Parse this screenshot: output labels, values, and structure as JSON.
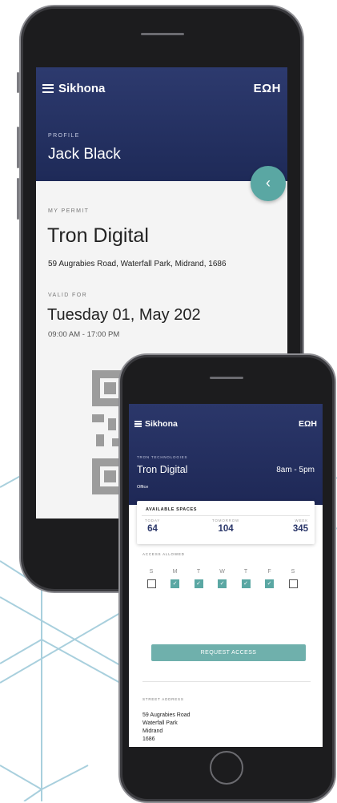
{
  "colors": {
    "header_navy": "#24316a",
    "accent_teal": "#5aa7a3",
    "pattern_blue": "#7fb6c9"
  },
  "icons": {
    "menu": "hamburger-icon",
    "back": "chevron-left-icon",
    "qr": "qr-code-icon",
    "check": "check-icon"
  },
  "large_screen": {
    "app_name": "Sikhona",
    "brand_logo": "EΩH",
    "profile_label": "PROFILE",
    "profile_name": "Jack Black",
    "back_button_glyph": "‹",
    "permit_label": "MY PERMIT",
    "company": "Tron Digital",
    "address": "59 Augrabies Road, Waterfall Park, Midrand, 1686",
    "valid_label": "VALID FOR",
    "date": "Tuesday 01, May 202",
    "time_range": "09:00 AM - 17:00 PM"
  },
  "small_screen": {
    "app_name": "Sikhona",
    "brand_logo": "EΩH",
    "company_label": "TRON TECHNOLOGIES",
    "company": "Tron Digital",
    "hours": "8am - 5pm",
    "space_type": "Office",
    "available": {
      "title": "AVAILABLE SPACES",
      "today_label": "TODAY",
      "today_value": "64",
      "tomorrow_label": "TOMORROW",
      "tomorrow_value": "104",
      "week_label": "WEEK",
      "week_value": "345"
    },
    "access_label": "ACCESS ALLOWED",
    "days": [
      {
        "label": "S",
        "checked": false
      },
      {
        "label": "M",
        "checked": true
      },
      {
        "label": "T",
        "checked": true
      },
      {
        "label": "W",
        "checked": true
      },
      {
        "label": "T",
        "checked": true
      },
      {
        "label": "F",
        "checked": true
      },
      {
        "label": "S",
        "checked": false
      }
    ],
    "request_button": "REQUEST ACCESS",
    "street_label": "STREET ADDRESS",
    "street_lines": [
      "59 Augrabies Road",
      "Waterfall Park",
      "Midrand",
      "1686"
    ]
  }
}
